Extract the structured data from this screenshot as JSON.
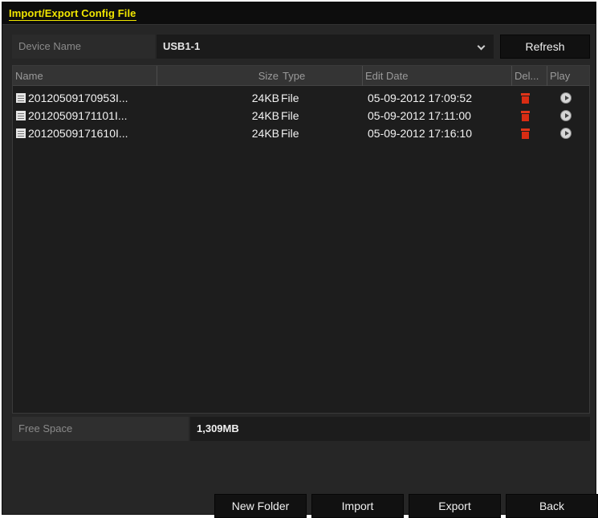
{
  "window": {
    "title": "Import/Export Config File"
  },
  "device": {
    "label": "Device Name",
    "selected": "USB1-1",
    "refresh_label": "Refresh"
  },
  "table": {
    "headers": [
      "Name",
      "Size",
      "Type",
      "Edit Date",
      "Del...",
      "Play"
    ],
    "rows": [
      {
        "name": "20120509170953I...",
        "size": "24KB",
        "type": "File",
        "date": "05-09-2012 17:09:52"
      },
      {
        "name": "20120509171101I...",
        "size": "24KB",
        "type": "File",
        "date": "05-09-2012 17:11:00"
      },
      {
        "name": "20120509171610I...",
        "size": "24KB",
        "type": "File",
        "date": "05-09-2012 17:16:10"
      }
    ]
  },
  "free_space": {
    "label": "Free Space",
    "value": "1,309MB"
  },
  "buttons": {
    "new_folder": "New Folder",
    "import": "Import",
    "export": "Export",
    "back": "Back"
  },
  "colors": {
    "title_accent": "#f1e600",
    "delete_icon": "#d92c13",
    "window_bg": "#262626"
  },
  "icons": {
    "row_file": "file-icon",
    "row_delete": "trash-icon",
    "row_play": "play-icon",
    "dropdown": "chevron-down-icon"
  }
}
